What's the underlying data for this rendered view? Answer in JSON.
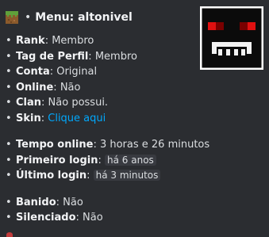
{
  "title": {
    "bullet": "•",
    "text": "Menu: altonivel"
  },
  "rows": [
    {
      "key": "Rank",
      "sep": ": ",
      "value": "Membro"
    },
    {
      "key": "Tag de Perfil",
      "sep": ": ",
      "value": "Membro"
    },
    {
      "key": "Conta",
      "sep": ": ",
      "value": "Original"
    },
    {
      "key": "Online",
      "sep": ": ",
      "value": "Não"
    },
    {
      "key": "Clan",
      "sep": ": ",
      "value": "Não possui."
    },
    {
      "key": "Skin",
      "sep": ": ",
      "link": "Clique aqui"
    }
  ],
  "times": [
    {
      "key": "Tempo online",
      "sep": ": ",
      "value": "3 horas e 26 minutos"
    },
    {
      "key": "Primeiro login",
      "sep": ": ",
      "code": "há 6 anos"
    },
    {
      "key": "Último login",
      "sep": ": ",
      "code": "há 3 minutos"
    }
  ],
  "status": [
    {
      "key": "Banido",
      "sep": ": ",
      "value": "Não"
    },
    {
      "key": "Silenciado",
      "sep": ": ",
      "value": "Não"
    }
  ],
  "icons": {
    "title_icon": "grass-block-icon",
    "thumbnail": "skin-face-thumbnail"
  },
  "colors": {
    "background": "#2b2d31",
    "link": "#00a8fc",
    "eye": "#e01010"
  }
}
